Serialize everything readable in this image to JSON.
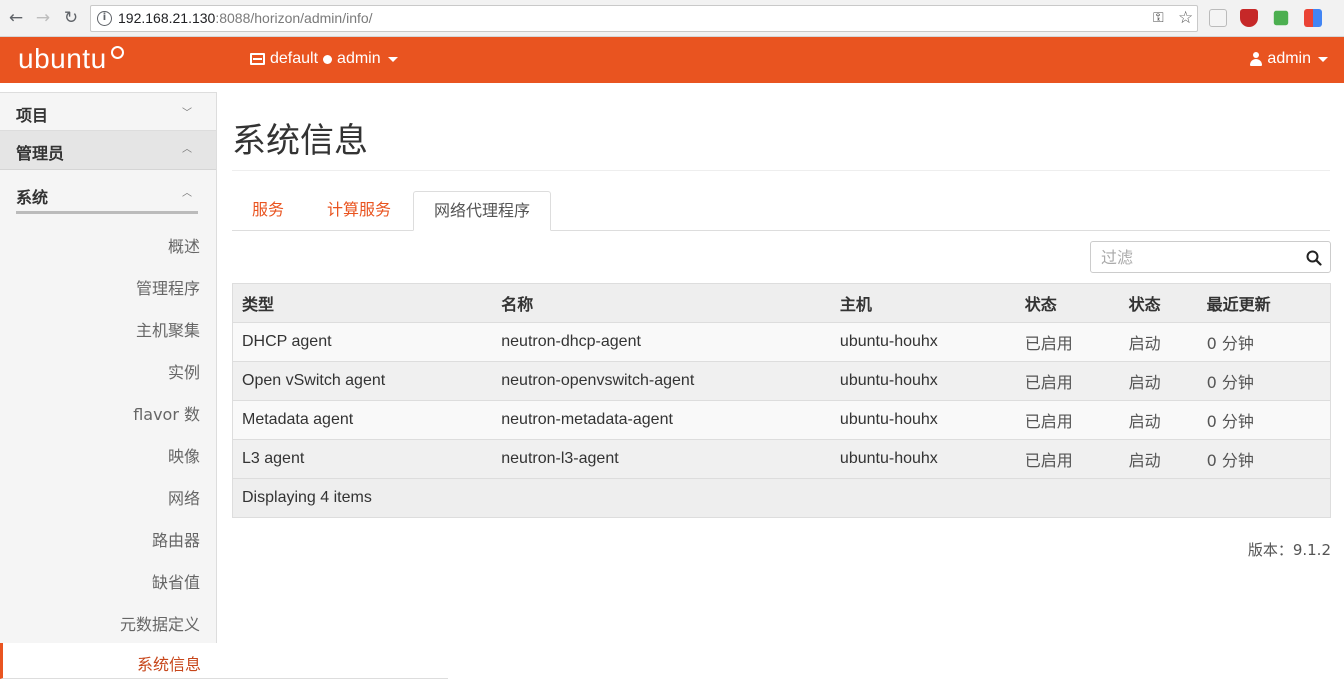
{
  "browser": {
    "url_host": "192.168.21.130",
    "url_rest": ":8088/horizon/admin/info/"
  },
  "header": {
    "logo": "ubuntu",
    "project_domain": "default",
    "project_name": "admin",
    "user": "admin",
    "brand_color": "#e95420"
  },
  "sidebar": {
    "project_label": "项目",
    "admin_label": "管理员",
    "system_label": "系统",
    "items": [
      "概述",
      "管理程序",
      "主机聚集",
      "实例",
      "flavor 数",
      "映像",
      "网络",
      "路由器",
      "缺省值",
      "元数据定义"
    ],
    "active_item": "系统信息"
  },
  "main": {
    "title": "系统信息",
    "tabs": [
      {
        "label": "服务",
        "active": false
      },
      {
        "label": "计算服务",
        "active": false
      },
      {
        "label": "网络代理程序",
        "active": true
      }
    ],
    "filter_placeholder": "过滤",
    "table": {
      "columns": [
        "类型",
        "名称",
        "主机",
        "状态",
        "状态",
        "最近更新"
      ],
      "rows": [
        [
          "DHCP agent",
          "neutron-dhcp-agent",
          "ubuntu-houhx",
          "已启用",
          "启动",
          "0 分钟"
        ],
        [
          "Open vSwitch agent",
          "neutron-openvswitch-agent",
          "ubuntu-houhx",
          "已启用",
          "启动",
          "0 分钟"
        ],
        [
          "Metadata agent",
          "neutron-metadata-agent",
          "ubuntu-houhx",
          "已启用",
          "启动",
          "0 分钟"
        ],
        [
          "L3 agent",
          "neutron-l3-agent",
          "ubuntu-houhx",
          "已启用",
          "启动",
          "0 分钟"
        ]
      ],
      "footer": "Displaying 4 items"
    },
    "version": "版本：9.1.2"
  }
}
